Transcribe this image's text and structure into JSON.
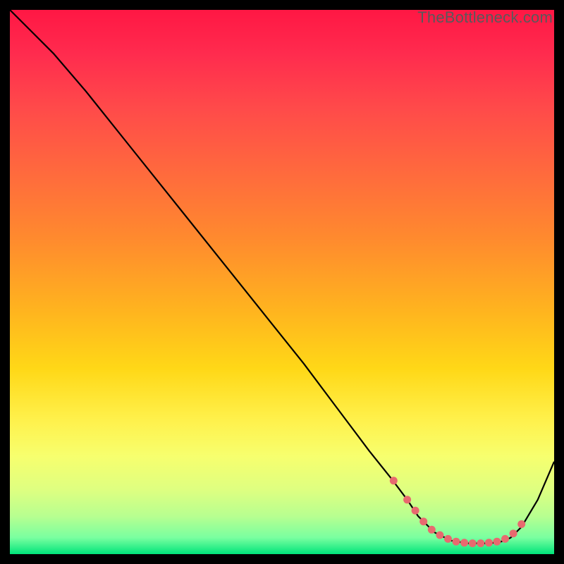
{
  "watermark": "TheBottleneck.com",
  "chart_data": {
    "type": "line",
    "title": "",
    "xlabel": "",
    "ylabel": "",
    "xlim": [
      0,
      100
    ],
    "ylim": [
      0,
      100
    ],
    "grid": false,
    "series": [
      {
        "name": "curve",
        "x": [
          0,
          4,
          8,
          14,
          22,
          30,
          38,
          46,
          54,
          60,
          66,
          70,
          73,
          75,
          78,
          81,
          84,
          86,
          88,
          90,
          92,
          94,
          97,
          100
        ],
        "y": [
          100,
          96,
          92,
          85,
          75,
          65,
          55,
          45,
          35,
          27,
          19,
          14,
          10,
          7,
          4,
          2.5,
          2,
          2,
          2,
          2.2,
          3,
          5,
          10,
          17
        ]
      }
    ],
    "markers": {
      "name": "highlight-dots",
      "x": [
        70.5,
        73,
        74.5,
        76,
        77.5,
        79,
        80.5,
        82,
        83.5,
        85,
        86.5,
        88,
        89.5,
        91,
        92.5,
        94
      ],
      "y": [
        13.5,
        10,
        8,
        6,
        4.5,
        3.5,
        2.8,
        2.3,
        2.1,
        2,
        2,
        2.1,
        2.3,
        2.8,
        3.8,
        5.5
      ]
    },
    "colors": {
      "line": "#000000",
      "marker": "#e86a6f"
    }
  }
}
